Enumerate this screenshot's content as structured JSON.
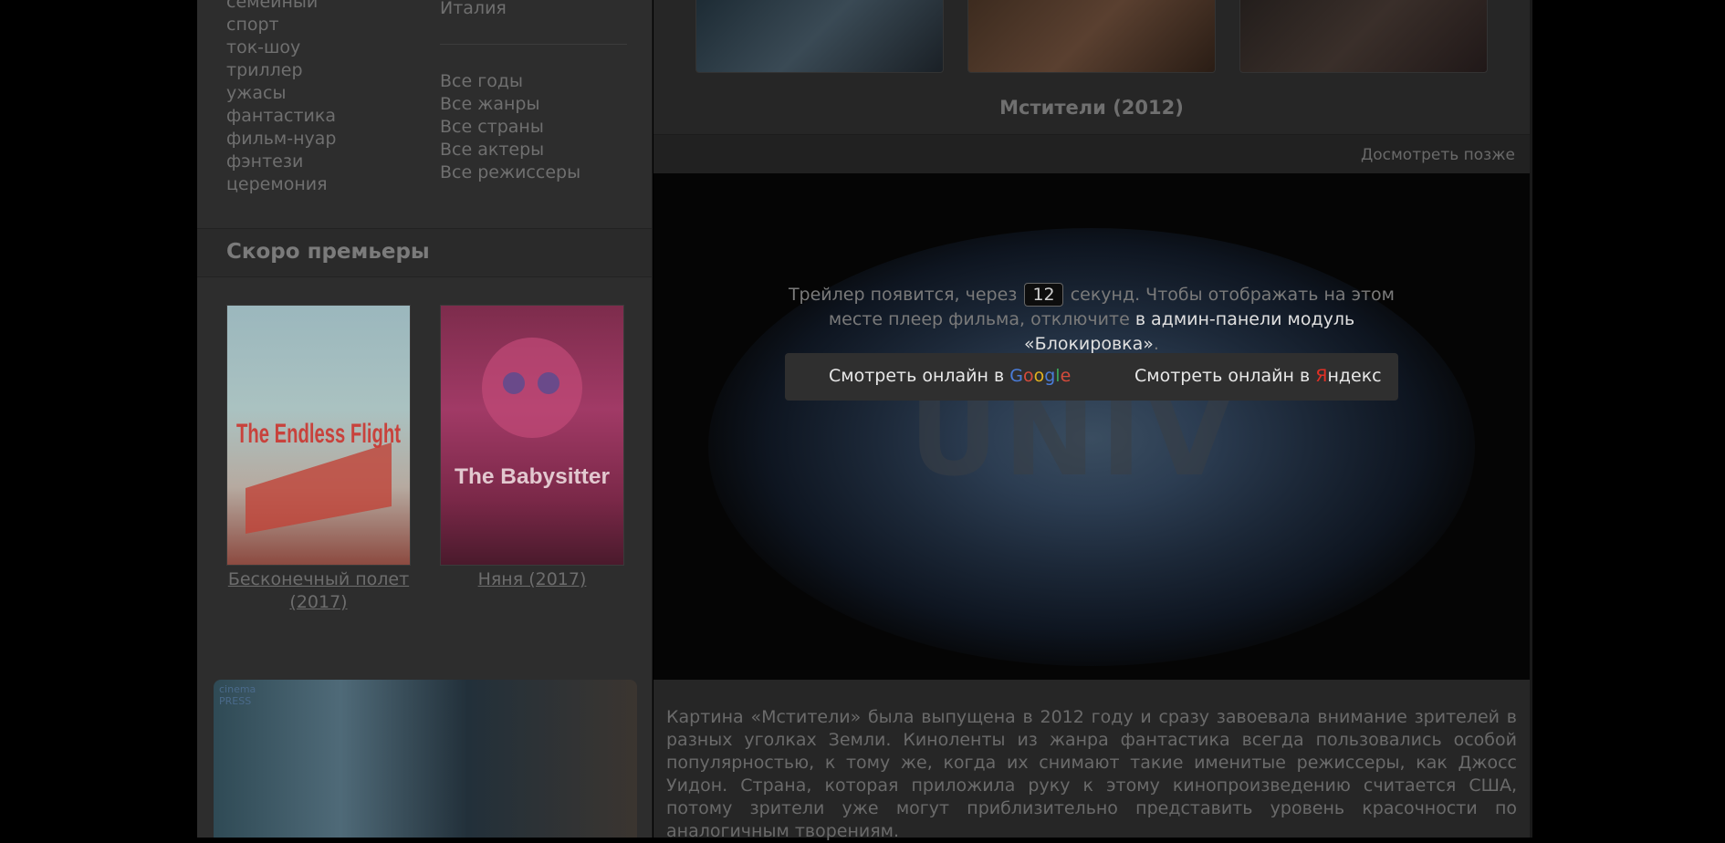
{
  "sidebar": {
    "genres": [
      "семейный",
      "спорт",
      "ток-шоу",
      "триллер",
      "ужасы",
      "фантастика",
      "фильм-нуар",
      "фэнтези",
      "церемония"
    ],
    "country": "Италия",
    "links": [
      "Все годы",
      "Все жанры",
      "Все страны",
      "Все актеры",
      "Все режиссеры"
    ],
    "soon_title": "Скоро премьеры",
    "premieres": [
      {
        "title": "Бесконечный полет (2017)",
        "poster": "The Endless Flight"
      },
      {
        "title": "Няня (2017)",
        "poster": "The Babysitter"
      }
    ],
    "banner_logo": "cinema PRESS"
  },
  "main": {
    "movie_title": "Мстители (2012)",
    "watch_later": "Досмотреть позже",
    "player": {
      "notice_before": "Трейлер появится, через",
      "counter": "12",
      "notice_after": "секунд. Чтобы отображать на этом месте плеер фильма, отключите",
      "notice_link": "в админ-панели модуль «Блокировка»",
      "notice_end": ".",
      "background_text": "UNIV",
      "google_prefix": "Смотреть онлайн в",
      "google": [
        "G",
        "o",
        "o",
        "g",
        "l",
        "e"
      ],
      "yandex_prefix": "Смотреть онлайн в",
      "yandex_first": "Я",
      "yandex_rest": "ндекс"
    },
    "description": "Картина «Мстители» была выпущена в 2012 году и сразу завоевала внимание зрителей в разных уголках Земли. Киноленты из жанра фантастика всегда пользовались особой популярностью, к тому же, когда их снимают такие именитые режиссеры, как Джосс Уидон. Страна, которая приложила руку к этому кинопроизведению считается США, потому зрители уже могут приблизительно представить уровень красочности по аналогичным творениям."
  }
}
